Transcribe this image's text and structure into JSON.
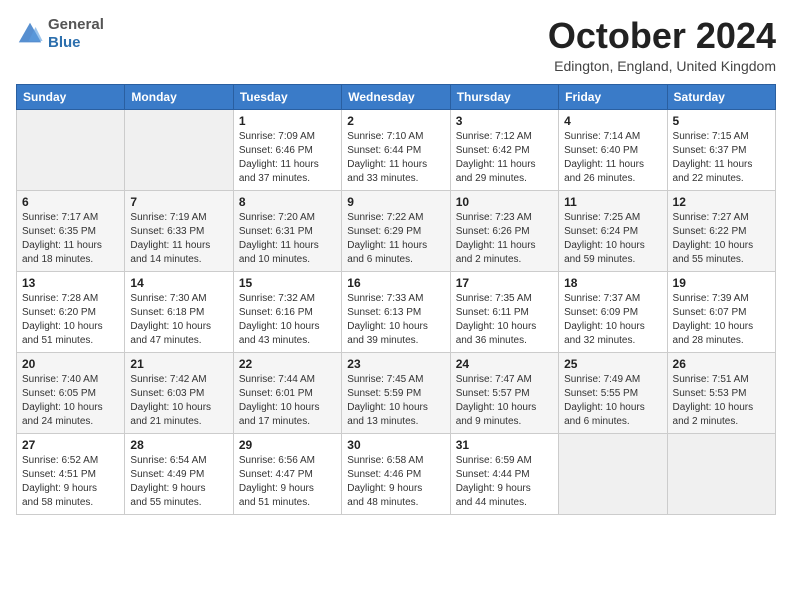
{
  "header": {
    "logo_general": "General",
    "logo_blue": "Blue",
    "month_title": "October 2024",
    "location": "Edington, England, United Kingdom"
  },
  "days_of_week": [
    "Sunday",
    "Monday",
    "Tuesday",
    "Wednesday",
    "Thursday",
    "Friday",
    "Saturday"
  ],
  "weeks": [
    [
      {
        "day": "",
        "info": ""
      },
      {
        "day": "",
        "info": ""
      },
      {
        "day": "1",
        "info": "Sunrise: 7:09 AM\nSunset: 6:46 PM\nDaylight: 11 hours\nand 37 minutes."
      },
      {
        "day": "2",
        "info": "Sunrise: 7:10 AM\nSunset: 6:44 PM\nDaylight: 11 hours\nand 33 minutes."
      },
      {
        "day": "3",
        "info": "Sunrise: 7:12 AM\nSunset: 6:42 PM\nDaylight: 11 hours\nand 29 minutes."
      },
      {
        "day": "4",
        "info": "Sunrise: 7:14 AM\nSunset: 6:40 PM\nDaylight: 11 hours\nand 26 minutes."
      },
      {
        "day": "5",
        "info": "Sunrise: 7:15 AM\nSunset: 6:37 PM\nDaylight: 11 hours\nand 22 minutes."
      }
    ],
    [
      {
        "day": "6",
        "info": "Sunrise: 7:17 AM\nSunset: 6:35 PM\nDaylight: 11 hours\nand 18 minutes."
      },
      {
        "day": "7",
        "info": "Sunrise: 7:19 AM\nSunset: 6:33 PM\nDaylight: 11 hours\nand 14 minutes."
      },
      {
        "day": "8",
        "info": "Sunrise: 7:20 AM\nSunset: 6:31 PM\nDaylight: 11 hours\nand 10 minutes."
      },
      {
        "day": "9",
        "info": "Sunrise: 7:22 AM\nSunset: 6:29 PM\nDaylight: 11 hours\nand 6 minutes."
      },
      {
        "day": "10",
        "info": "Sunrise: 7:23 AM\nSunset: 6:26 PM\nDaylight: 11 hours\nand 2 minutes."
      },
      {
        "day": "11",
        "info": "Sunrise: 7:25 AM\nSunset: 6:24 PM\nDaylight: 10 hours\nand 59 minutes."
      },
      {
        "day": "12",
        "info": "Sunrise: 7:27 AM\nSunset: 6:22 PM\nDaylight: 10 hours\nand 55 minutes."
      }
    ],
    [
      {
        "day": "13",
        "info": "Sunrise: 7:28 AM\nSunset: 6:20 PM\nDaylight: 10 hours\nand 51 minutes."
      },
      {
        "day": "14",
        "info": "Sunrise: 7:30 AM\nSunset: 6:18 PM\nDaylight: 10 hours\nand 47 minutes."
      },
      {
        "day": "15",
        "info": "Sunrise: 7:32 AM\nSunset: 6:16 PM\nDaylight: 10 hours\nand 43 minutes."
      },
      {
        "day": "16",
        "info": "Sunrise: 7:33 AM\nSunset: 6:13 PM\nDaylight: 10 hours\nand 39 minutes."
      },
      {
        "day": "17",
        "info": "Sunrise: 7:35 AM\nSunset: 6:11 PM\nDaylight: 10 hours\nand 36 minutes."
      },
      {
        "day": "18",
        "info": "Sunrise: 7:37 AM\nSunset: 6:09 PM\nDaylight: 10 hours\nand 32 minutes."
      },
      {
        "day": "19",
        "info": "Sunrise: 7:39 AM\nSunset: 6:07 PM\nDaylight: 10 hours\nand 28 minutes."
      }
    ],
    [
      {
        "day": "20",
        "info": "Sunrise: 7:40 AM\nSunset: 6:05 PM\nDaylight: 10 hours\nand 24 minutes."
      },
      {
        "day": "21",
        "info": "Sunrise: 7:42 AM\nSunset: 6:03 PM\nDaylight: 10 hours\nand 21 minutes."
      },
      {
        "day": "22",
        "info": "Sunrise: 7:44 AM\nSunset: 6:01 PM\nDaylight: 10 hours\nand 17 minutes."
      },
      {
        "day": "23",
        "info": "Sunrise: 7:45 AM\nSunset: 5:59 PM\nDaylight: 10 hours\nand 13 minutes."
      },
      {
        "day": "24",
        "info": "Sunrise: 7:47 AM\nSunset: 5:57 PM\nDaylight: 10 hours\nand 9 minutes."
      },
      {
        "day": "25",
        "info": "Sunrise: 7:49 AM\nSunset: 5:55 PM\nDaylight: 10 hours\nand 6 minutes."
      },
      {
        "day": "26",
        "info": "Sunrise: 7:51 AM\nSunset: 5:53 PM\nDaylight: 10 hours\nand 2 minutes."
      }
    ],
    [
      {
        "day": "27",
        "info": "Sunrise: 6:52 AM\nSunset: 4:51 PM\nDaylight: 9 hours\nand 58 minutes."
      },
      {
        "day": "28",
        "info": "Sunrise: 6:54 AM\nSunset: 4:49 PM\nDaylight: 9 hours\nand 55 minutes."
      },
      {
        "day": "29",
        "info": "Sunrise: 6:56 AM\nSunset: 4:47 PM\nDaylight: 9 hours\nand 51 minutes."
      },
      {
        "day": "30",
        "info": "Sunrise: 6:58 AM\nSunset: 4:46 PM\nDaylight: 9 hours\nand 48 minutes."
      },
      {
        "day": "31",
        "info": "Sunrise: 6:59 AM\nSunset: 4:44 PM\nDaylight: 9 hours\nand 44 minutes."
      },
      {
        "day": "",
        "info": ""
      },
      {
        "day": "",
        "info": ""
      }
    ]
  ]
}
